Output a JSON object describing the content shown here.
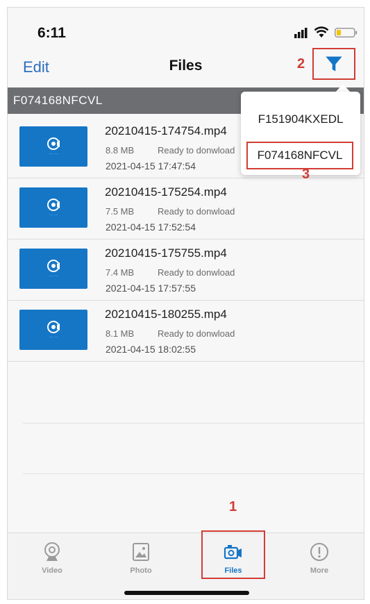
{
  "status_bar": {
    "time": "6:11"
  },
  "nav": {
    "edit_label": "Edit",
    "title": "Files"
  },
  "annotations": {
    "step1": "1",
    "step2": "2",
    "step3": "3"
  },
  "device_header": "F074168NFCVL",
  "dropdown": {
    "items": [
      "F151904KXEDL",
      "F074168NFCVL"
    ],
    "selected": "F074168NFCVL"
  },
  "files": [
    {
      "name": "20210415-174754.mp4",
      "size": "8.8 MB",
      "status": "Ready to donwload",
      "date": "2021-04-15 17:47:54"
    },
    {
      "name": "20210415-175254.mp4",
      "size": "7.5 MB",
      "status": "Ready to donwload",
      "date": "2021-04-15 17:52:54"
    },
    {
      "name": "20210415-175755.mp4",
      "size": "7.4 MB",
      "status": "Ready to donwload",
      "date": "2021-04-15 17:57:55"
    },
    {
      "name": "20210415-180255.mp4",
      "size": "8.1 MB",
      "status": "Ready to donwload",
      "date": "2021-04-15 18:02:55"
    }
  ],
  "tabs": [
    {
      "label": "Video",
      "icon": "webcam-icon"
    },
    {
      "label": "Photo",
      "icon": "photo-icon"
    },
    {
      "label": "Files",
      "icon": "files-camera-icon",
      "active": true
    },
    {
      "label": "More",
      "icon": "info-icon"
    }
  ],
  "colors": {
    "accent": "#1576c6",
    "annotation_red": "#d23c34",
    "header_gray": "#6c6e71"
  }
}
